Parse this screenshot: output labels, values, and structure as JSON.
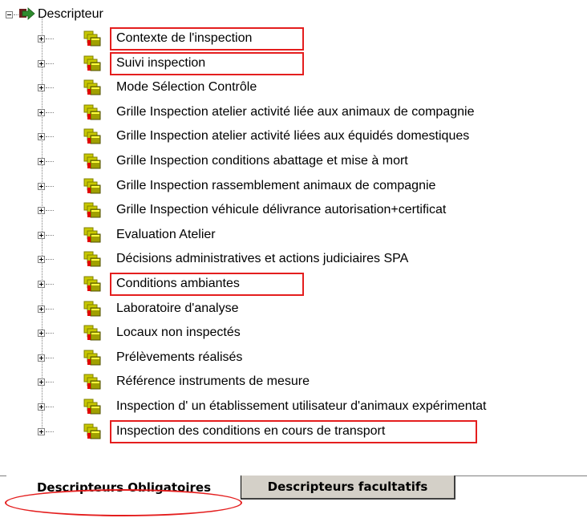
{
  "tree": {
    "root_label": "Descripteur",
    "items": [
      {
        "label": "Contexte de l'inspection",
        "highlighted": true
      },
      {
        "label": "Suivi inspection",
        "highlighted": true
      },
      {
        "label": "Mode Sélection Contrôle",
        "highlighted": false
      },
      {
        "label": "Grille Inspection atelier activité liée aux animaux de compagnie",
        "highlighted": false
      },
      {
        "label": "Grille Inspection atelier activité liées aux équidés domestiques",
        "highlighted": false
      },
      {
        "label": "Grille Inspection conditions abattage et mise à mort",
        "highlighted": false
      },
      {
        "label": "Grille Inspection rassemblement animaux de compagnie",
        "highlighted": false
      },
      {
        "label": "Grille Inspection véhicule délivrance autorisation+certificat",
        "highlighted": false
      },
      {
        "label": "Evaluation Atelier",
        "highlighted": false
      },
      {
        "label": "Décisions administratives et actions judiciaires SPA",
        "highlighted": false
      },
      {
        "label": "Conditions ambiantes",
        "highlighted": true
      },
      {
        "label": "Laboratoire d'analyse",
        "highlighted": false
      },
      {
        "label": "Locaux non inspectés",
        "highlighted": false
      },
      {
        "label": "Prélèvements réalisés",
        "highlighted": false
      },
      {
        "label": "Référence instruments de mesure",
        "highlighted": false
      },
      {
        "label": "Inspection d' un établissement utilisateur d'animaux expérimentat",
        "highlighted": false
      },
      {
        "label": "Inspection des conditions en cours de transport",
        "highlighted": true
      }
    ]
  },
  "tabs": [
    {
      "label": "Descripteurs Obligatoires",
      "active": true,
      "highlighted": true
    },
    {
      "label": "Descripteurs facultatifs",
      "active": false,
      "highlighted": false
    }
  ],
  "colors": {
    "highlight": "#e41e1e",
    "root_arrow": "#2e8b2e",
    "folder_yellow": "#c8c800",
    "folder_dark": "#808000",
    "folder_red": "#e00000",
    "tab_inactive_bg": "#d4d0c8"
  },
  "icons": {
    "root": "green-arrow-icon",
    "item": "stacked-folders-icon",
    "expander_root": "minus-box-icon",
    "expander_item": "plus-box-icon"
  }
}
